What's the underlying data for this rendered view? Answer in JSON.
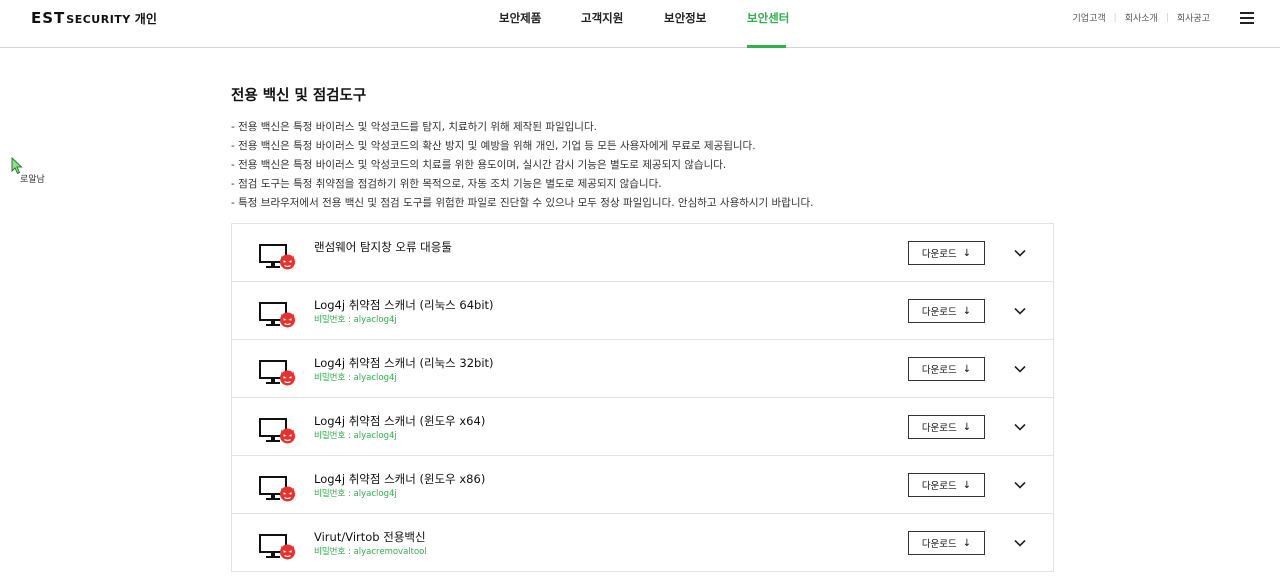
{
  "header": {
    "logo_main": "EST",
    "logo_sub": "SECURITY",
    "logo_ko": "개인",
    "nav": [
      "보안제품",
      "고객지원",
      "보안정보",
      "보안센터"
    ],
    "util": [
      "기업고객",
      "회사소개",
      "회사공고"
    ]
  },
  "side": {
    "label": "로알남"
  },
  "colors": {
    "accent": "#2cb34a",
    "danger": "#e8312f"
  },
  "main": {
    "title": "전용 백신 및 점검도구",
    "descriptions": [
      "- 전용 백신은 특정 바이러스 및 악성코드를 탐지, 치료하기 위해 제작된 파일입니다.",
      "- 전용 백신은 특정 바이러스 및 악성코드의 확산 방지 및 예방을 위해 개인, 기업 등 모든 사용자에게 무료로 제공됩니다.",
      "- 전용 백신은 특정 바이러스 및 악성코드의 치료를 위한 용도이며, 실시간 감시 기능은 별도로 제공되지 않습니다.",
      "- 점검 도구는 특정 취약점을 점검하기 위한 목적으로, 자동 조치 기능은 별도로 제공되지 않습니다.",
      "- 특정 브라우저에서 전용 백신 및 점검 도구를 위험한 파일로 진단할 수 있으나 모두 정상 파일입니다. 안심하고 사용하시기 바랍니다."
    ],
    "download_label": "다운로드",
    "items": [
      {
        "title": "랜섬웨어 탐지창 오류 대응툴",
        "password": ""
      },
      {
        "title": "Log4j 취약점 스캐너 (리눅스 64bit)",
        "password": "비밀번호 : alyaclog4j"
      },
      {
        "title": "Log4j 취약점 스캐너 (리눅스 32bit)",
        "password": "비밀번호 : alyaclog4j"
      },
      {
        "title": "Log4j 취약점 스캐너 (윈도우 x64)",
        "password": "비밀번호 : alyaclog4j"
      },
      {
        "title": "Log4j 취약점 스캐너 (윈도우 x86)",
        "password": "비밀번호 : alyaclog4j"
      },
      {
        "title": "Virut/Virtob 전용백신",
        "password": "비밀번호 : alyacremovaltool"
      }
    ]
  }
}
